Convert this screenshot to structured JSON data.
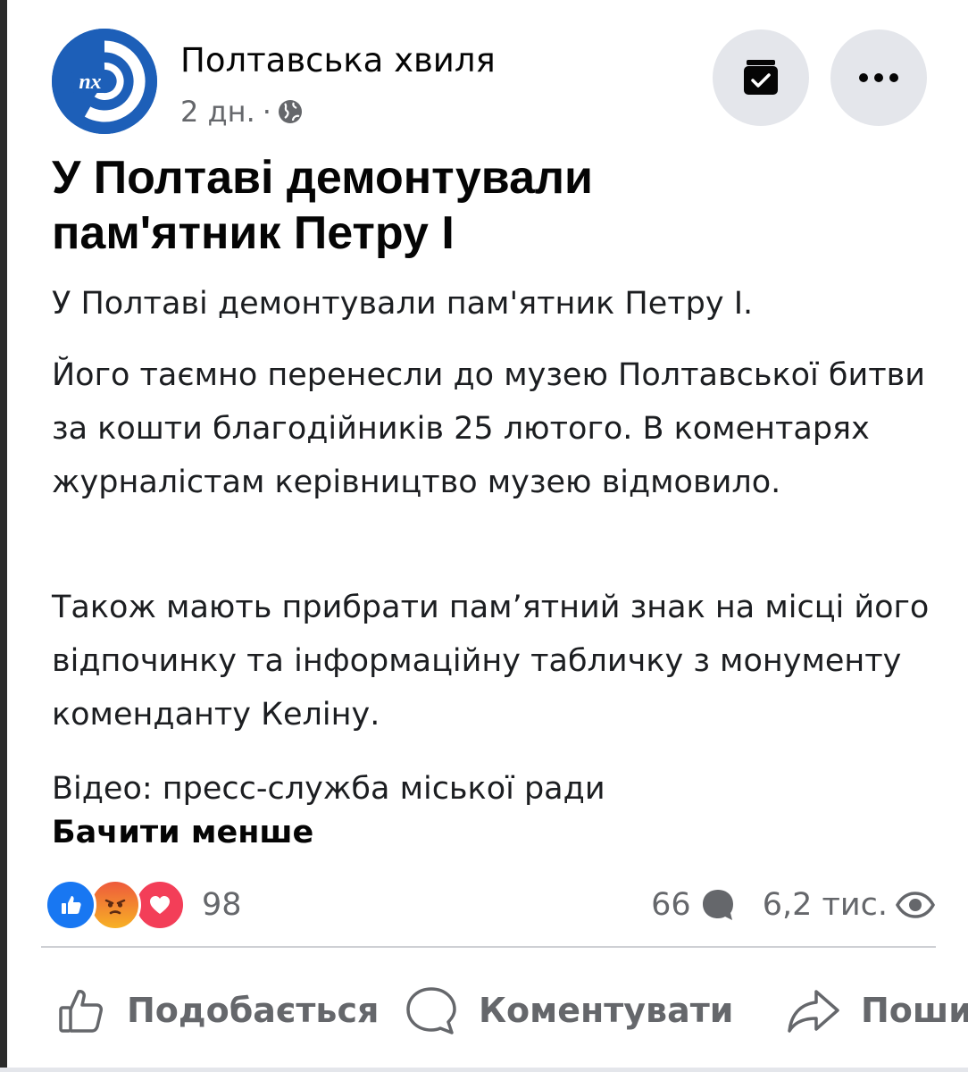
{
  "header": {
    "page_name": "Полтавська хвиля",
    "avatar_text": "пх",
    "time": "2 дн.",
    "separator": "·"
  },
  "post": {
    "headline_line1": "У Полтаві демонтували",
    "headline_line2": "пам'ятник Петру І",
    "paragraphs": [
      "У Полтаві демонтували пам'ятник Петру І.",
      "Його таємно перенесли до музею Полтавської битви за кошти благодійників 25 лютого. В коментарях журналістам керівництво музею відмовило.",
      "Також мають прибрати пам’ятний знак на місці його відпочинку та інформаційну табличку з монументу коменданту Келіну.",
      "Відео: пресс-служба міської ради"
    ],
    "see_less": "Бачити менше"
  },
  "stats": {
    "reactions_count": "98",
    "reaction_icons": [
      "like-reaction-icon",
      "angry-reaction-icon",
      "love-reaction-icon"
    ],
    "comments_count": "66",
    "views_count": "6,2 тис."
  },
  "actions": {
    "like": "Подобається",
    "comment": "Коментувати",
    "share": "Поши"
  },
  "colors": {
    "avatar_bg": "#1d5fb8",
    "like_blue": "#1877f2",
    "love_red": "#f33e58",
    "secondary_text": "#65676b",
    "button_bg": "#e4e6eb"
  }
}
